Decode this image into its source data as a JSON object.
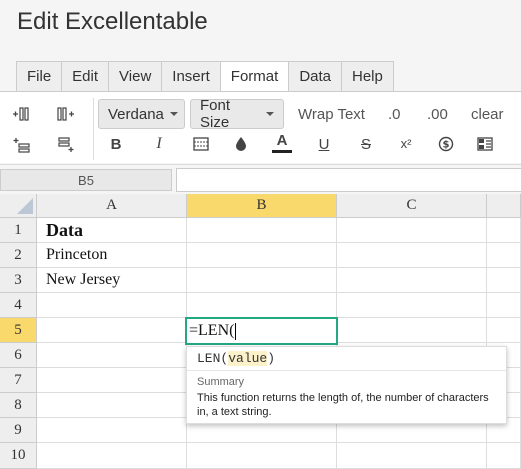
{
  "app": {
    "title": "Edit Excellentable"
  },
  "menu": {
    "tabs": [
      "File",
      "Edit",
      "View",
      "Insert",
      "Format",
      "Data",
      "Help"
    ],
    "active": "Format"
  },
  "toolbar": {
    "font_family": "Verdana",
    "font_size": "Font Size",
    "wrap_text": "Wrap Text",
    "decimal_decrease": ".0",
    "decimal_increase": ".00",
    "clear": "clear",
    "bold": "B",
    "italic": "I",
    "font_color": "A",
    "underline": "U",
    "strikethrough": "S",
    "superscript": "x²",
    "icons": [
      "insert-column-left-icon",
      "insert-column-right-icon",
      "insert-row-above-icon",
      "insert-row-below-icon",
      "border-icon",
      "fill-color-icon",
      "currency-icon",
      "merge-cells-icon"
    ]
  },
  "formula_bar": {
    "cell_ref": "B5",
    "value": ""
  },
  "grid": {
    "columns": [
      "A",
      "B",
      "C"
    ],
    "rows": [
      "1",
      "2",
      "3",
      "4",
      "5",
      "6",
      "7",
      "8",
      "9",
      "10"
    ],
    "active_column": "B",
    "active_row": "5",
    "cells": {
      "A1": "Data",
      "A2": "Princeton",
      "A3": "New Jersey"
    }
  },
  "editor": {
    "value": "=LEN("
  },
  "autocomplete": {
    "function": "LEN",
    "open_paren": "(",
    "param": "value",
    "close_paren": ")",
    "summary_label": "Summary",
    "summary": "This function returns the length of, the number of characters in, a text string."
  },
  "colors": {
    "active_header": "#f9d96b",
    "editor_border": "#23a884",
    "font_color_underline": "#222222"
  }
}
